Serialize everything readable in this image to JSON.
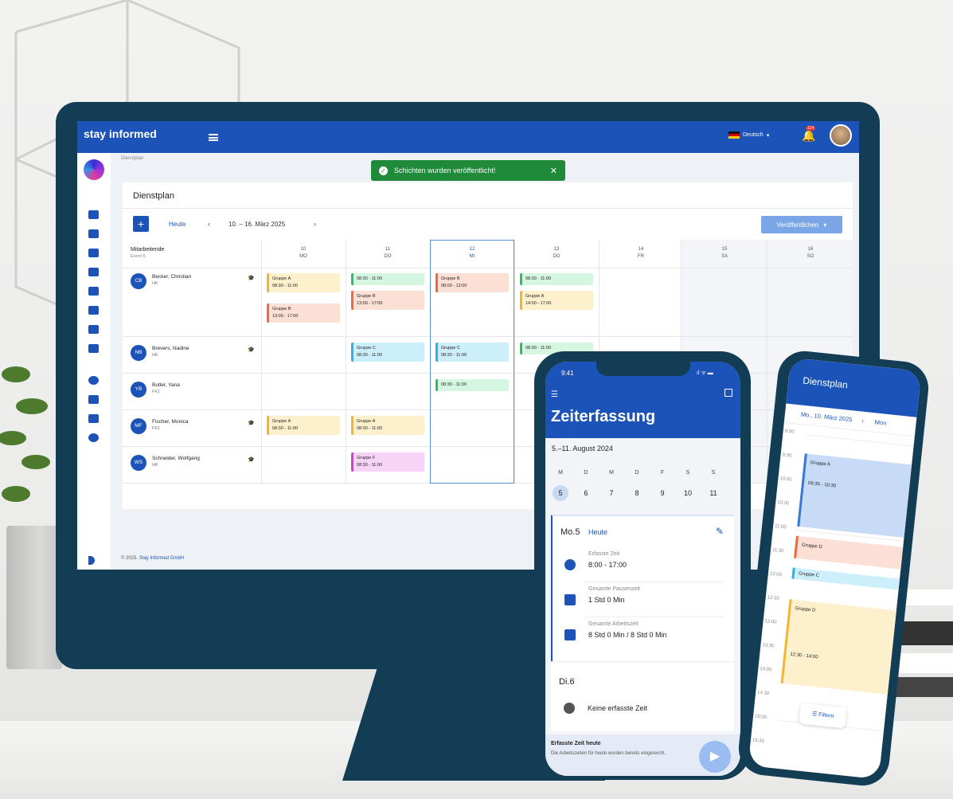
{
  "desktop": {
    "brand": "stay informed",
    "language": "Deutsch",
    "notification_count": "114",
    "breadcrumb": "Dienstplan",
    "toast": "Schichten wurden veröffentlicht!",
    "card_title": "Dienstplan",
    "today_label": "Heute",
    "date_range": "10. – 16. März 2025",
    "publish_label": "Veröffentlichen",
    "employees_header": "Mitarbeitende",
    "employees_sub": "Event 5",
    "days": [
      {
        "num": "10",
        "wd": "MO"
      },
      {
        "num": "11",
        "wd": "DO"
      },
      {
        "num": "12",
        "wd": "MI"
      },
      {
        "num": "13",
        "wd": "DO"
      },
      {
        "num": "14",
        "wd": "FR"
      },
      {
        "num": "15",
        "wd": "SA"
      },
      {
        "num": "16",
        "wd": "SO"
      }
    ],
    "employees": [
      {
        "initials": "CB",
        "name": "Becker, Christian",
        "dept": "HK"
      },
      {
        "initials": "NB",
        "name": "Brevers, Nadine",
        "dept": "HK"
      },
      {
        "initials": "YB",
        "name": "Butler, Yana",
        "dept": "FK1"
      },
      {
        "initials": "MF",
        "name": "Fischer, Monica",
        "dept": "FK1"
      },
      {
        "initials": "WS",
        "name": "Schneider, Wolfgang",
        "dept": "HK"
      }
    ],
    "shifts": [
      {
        "title": "Gruppe A",
        "time": "08:30 - 11:00"
      },
      {
        "title": "Gruppe B",
        "time": "13:00 - 17:00"
      },
      {
        "title": "",
        "time": "08:30 - 11:00"
      },
      {
        "title": "Gruppe B",
        "time": "13:00 - 17:00"
      },
      {
        "title": "Gruppe B",
        "time": "08:00 - 12:00"
      },
      {
        "title": "",
        "time": "08:30 - 11:00"
      },
      {
        "title": "Gruppe A",
        "time": "14:00 - 17:00"
      },
      {
        "title": "Gruppe C",
        "time": "08:30 - 11:00"
      },
      {
        "title": "Gruppe C",
        "time": "08:30 - 11:00"
      },
      {
        "title": "",
        "time": "08:30 - 11:00"
      },
      {
        "title": "",
        "time": "08:30 - 11:00"
      },
      {
        "title": "Gruppe A",
        "time": "08:30 - 11:00"
      },
      {
        "title": "Gruppe A",
        "time": "08:30 - 11:00"
      },
      {
        "title": "Gruppe F",
        "time": "08:30 - 11:00"
      }
    ],
    "footer": "© 2025.",
    "footer_company": "Stay Informed GmbH"
  },
  "phone1": {
    "time": "9:41",
    "status": "ıl ᯤ ▬",
    "title": "Zeiterfassung",
    "week": "5.–11. August 2024",
    "weekdays": [
      "M",
      "D",
      "M",
      "D",
      "F",
      "S",
      "S"
    ],
    "daynums": [
      "5",
      "6",
      "7",
      "8",
      "9",
      "10",
      "11"
    ],
    "day_label": "Mo.5",
    "today": "Heute",
    "recorded_label": "Erfasste Zeit",
    "recorded_value": "8:00 - 17:00",
    "break_label": "Gesamte Pausenzeit",
    "break_value": "1 Std 0 Min",
    "work_label": "Gesamte Arbeitszeit",
    "work_value": "8 Std 0 Min / 8 Std 0 Min",
    "day2_label": "Di.6",
    "no_time": "Keine erfasste Zeit",
    "bottom_title": "Erfasste Zeit heute",
    "bottom_text": "Die Arbeitszeiten für heute wurden bereits eingereicht."
  },
  "phone2": {
    "title": "Dienstplan",
    "date": "Mo., 10. März 2025",
    "next": "Mon",
    "hours": [
      "9:00",
      "9:30",
      "10:00",
      "10:30",
      "11:00",
      "11:30",
      "12:00",
      "12:30",
      "13:00",
      "13:30",
      "14:00",
      "14:30",
      "15:00",
      "15:30"
    ],
    "events": [
      {
        "title": "Gruppe A",
        "time": "09:30 - 10:30"
      },
      {
        "title": "Gruppe D",
        "time": ""
      },
      {
        "title": "Gruppe C",
        "time": ""
      },
      {
        "title": "Gruppe D",
        "time": "12:30 - 14:00"
      }
    ],
    "filter": "Filtern"
  },
  "colors": {
    "brand_blue": "#1b53b8",
    "navy_device": "#123d55",
    "toast_green": "#1f8a3a"
  }
}
